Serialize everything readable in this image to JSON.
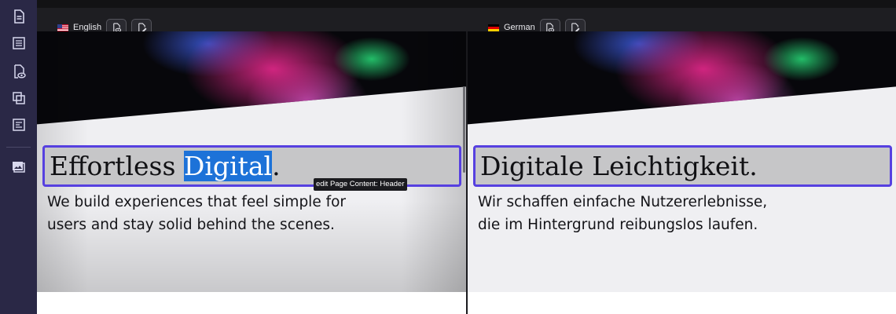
{
  "rail": {
    "icons": [
      "document-icon",
      "list-icon",
      "preview-icon",
      "copy-icon",
      "form-icon",
      "media-icon"
    ]
  },
  "languages": [
    {
      "label": "English",
      "flag": "us-flag-icon",
      "heading_before": "Effortless ",
      "heading_selected": "Digital",
      "heading_after": ".",
      "body_line1": "We build experiences that feel simple for",
      "body_line2": "users and stay solid behind the scenes."
    },
    {
      "label": "German",
      "flag": "de-flag-icon",
      "heading": "Digitale Leichtigkeit.",
      "body_line1": "Wir schaffen einfache Nutzererlebnisse,",
      "body_line2": "die im Hintergrund reibungslos laufen."
    }
  ],
  "tooltip": "edit Page Content: Header",
  "colors": {
    "rail_bg": "#2a2846",
    "selection_outline": "#5640e0",
    "text_selection": "#1d72d8"
  }
}
